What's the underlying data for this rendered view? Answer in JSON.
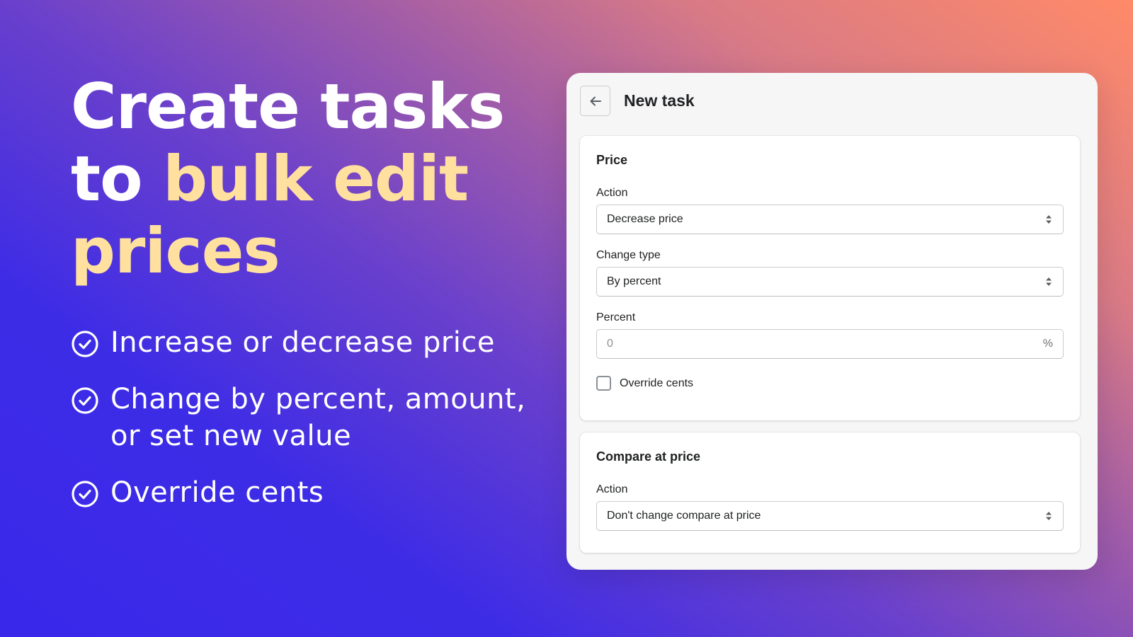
{
  "hero": {
    "headline": {
      "line1": "Create tasks",
      "line2_plain": "to ",
      "line2_highlight": "bulk edit",
      "line3_highlight": "prices"
    },
    "highlight_color": "#ffe09e",
    "features": [
      {
        "icon": "check-circle-icon",
        "lines": [
          "Increase or decrease price"
        ]
      },
      {
        "icon": "check-circle-icon",
        "lines": [
          "Change by percent, amount,",
          "or set new value"
        ]
      },
      {
        "icon": "check-circle-icon",
        "lines": [
          "Override cents"
        ]
      }
    ]
  },
  "panel": {
    "back_icon": "arrow-left-icon",
    "title": "New task",
    "price_card": {
      "title": "Price",
      "action": {
        "label": "Action",
        "value": "Decrease price"
      },
      "change_type": {
        "label": "Change type",
        "value": "By percent"
      },
      "percent": {
        "label": "Percent",
        "placeholder": "0",
        "value": "",
        "suffix": "%"
      },
      "override_cents": {
        "label": "Override cents",
        "checked": false
      }
    },
    "compare_card": {
      "title": "Compare at price",
      "action": {
        "label": "Action",
        "value": "Don't change compare at price"
      }
    }
  },
  "colors": {
    "gradient_start": "#3a28ea",
    "gradient_end": "#ff8a68",
    "panel_bg": "#f6f6f7",
    "text_primary": "#202223"
  }
}
